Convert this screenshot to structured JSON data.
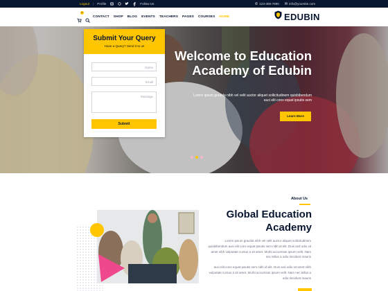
{
  "topbar": {
    "logout": "Logout",
    "profile": "Profile",
    "follow": "Follow Us",
    "phone": "123-456-7890",
    "email": "info@yoursite.com"
  },
  "header": {
    "nav": [
      "CONTACT",
      "SHOP",
      "BLOG",
      "EVENTS",
      "TEACHERS",
      "PAGES",
      "COURSES",
      "HOME"
    ],
    "active_nav": "HOME",
    "cart_count": "0",
    "logo": "EDUBIN"
  },
  "form": {
    "title": "Submit Your Query",
    "subtitle": "Have a Query? Send it to us",
    "name_placeholder": "Name",
    "email_placeholder": "Email",
    "message_placeholder": "Message",
    "submit": "Submit"
  },
  "hero": {
    "title": "Welcome to Education Academy of Edubin",
    "desc": "Lorem ipsum gravida nibh vel velit auctor aliquet sollicitudinem quisbibendum auci elit cons equat ipsutis sem",
    "button": "Learn More",
    "slides": 3,
    "active_slide": 2
  },
  "about": {
    "label": "About Us",
    "title": "Global Education Academy",
    "p1": "Lorem ipsum gravida nibh vel velit auctor aliquet sollicitudinem quisbibendum auci elit cons equat ipsutis sem nibh id elit. Duis sed odio sit amet nibh vulputate cursus a sit amet. Morbi accumsan ipsum velit. Nam nec tellus a odio tincidunt mauris",
    "p2": "auci elit cons equat ipsutis sem nibh id elit. Duis sed odio sit amet nibh vulputate cursus a sit amet. Morbi accumsan ipsum velit. Nam nec tellus a odio tincidunt mauris"
  },
  "colors": {
    "accent": "#ffc600",
    "navy": "#08152f",
    "pink": "#f0488c"
  }
}
